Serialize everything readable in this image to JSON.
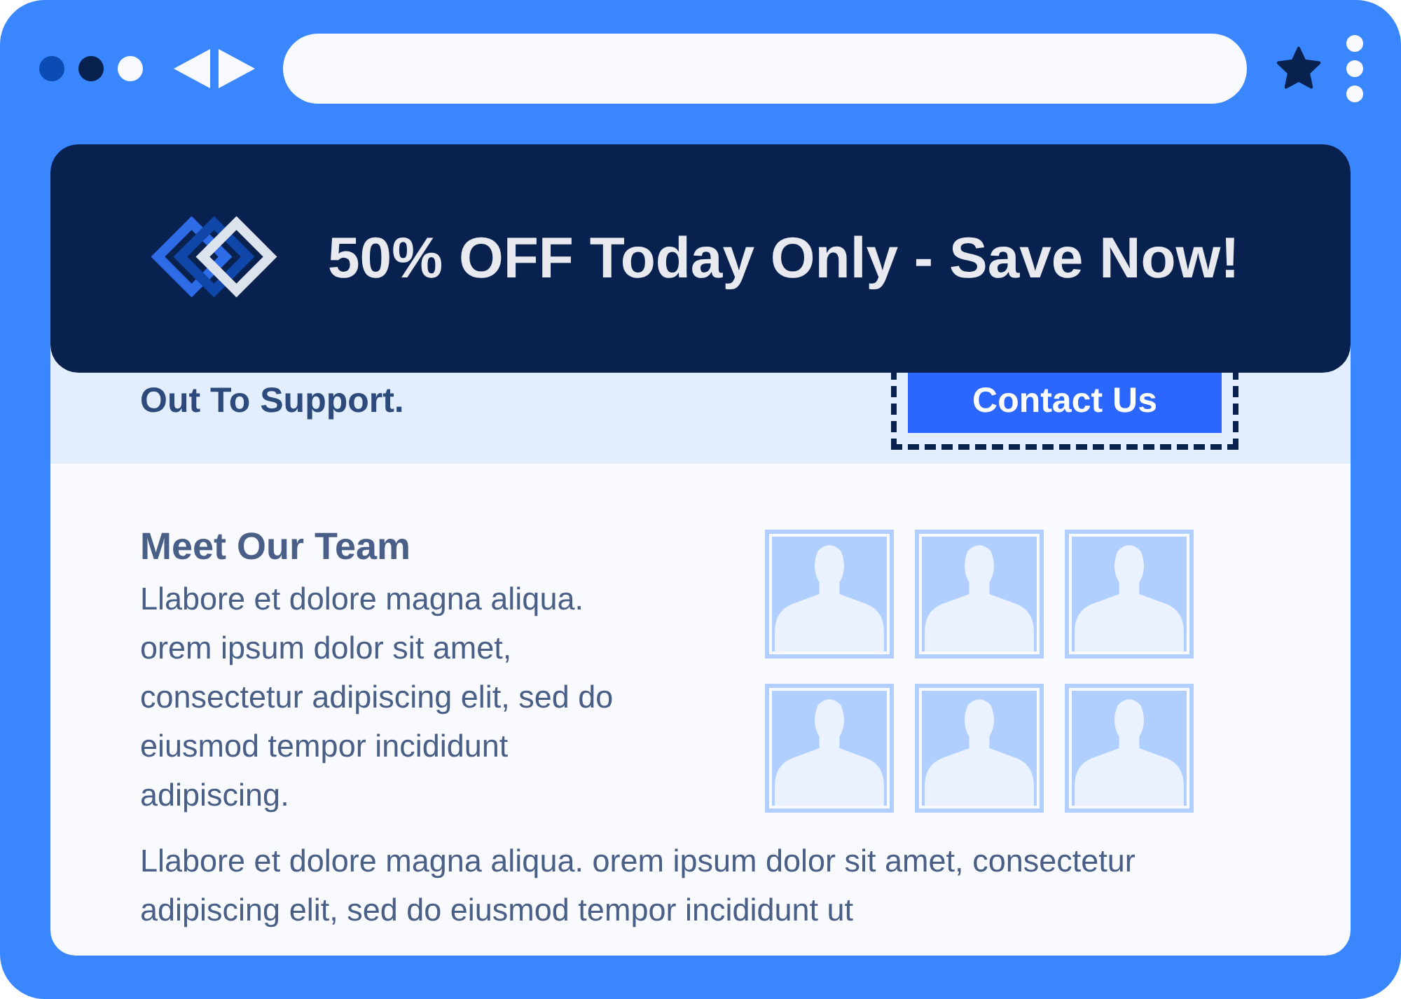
{
  "browser": {
    "dots": [
      {
        "color": "#0b4cb4"
      },
      {
        "color": "#08214f"
      },
      {
        "color": "#f8fafd"
      }
    ]
  },
  "banner": {
    "text": "50% OFF Today Only - Save Now!"
  },
  "support": {
    "text": "Out To Support.",
    "button": "Contact Us"
  },
  "team": {
    "heading": "Meet Our Team",
    "text": "Llabore et dolore magna aliqua. orem ipsum dolor sit amet, consectetur adipiscing elit, sed do eiusmod tempor incididunt adipiscing.",
    "avatars": [
      {
        "kind": "avatar"
      },
      {
        "kind": "avatar"
      },
      {
        "kind": "avatar"
      },
      {
        "kind": "avatar"
      },
      {
        "kind": "avatar"
      },
      {
        "kind": "avatar"
      }
    ],
    "footer_text": "Llabore et dolore magna aliqua.  orem ipsum dolor sit amet, consectetur adipiscing elit, sed do eiusmod tempor incididunt ut"
  }
}
